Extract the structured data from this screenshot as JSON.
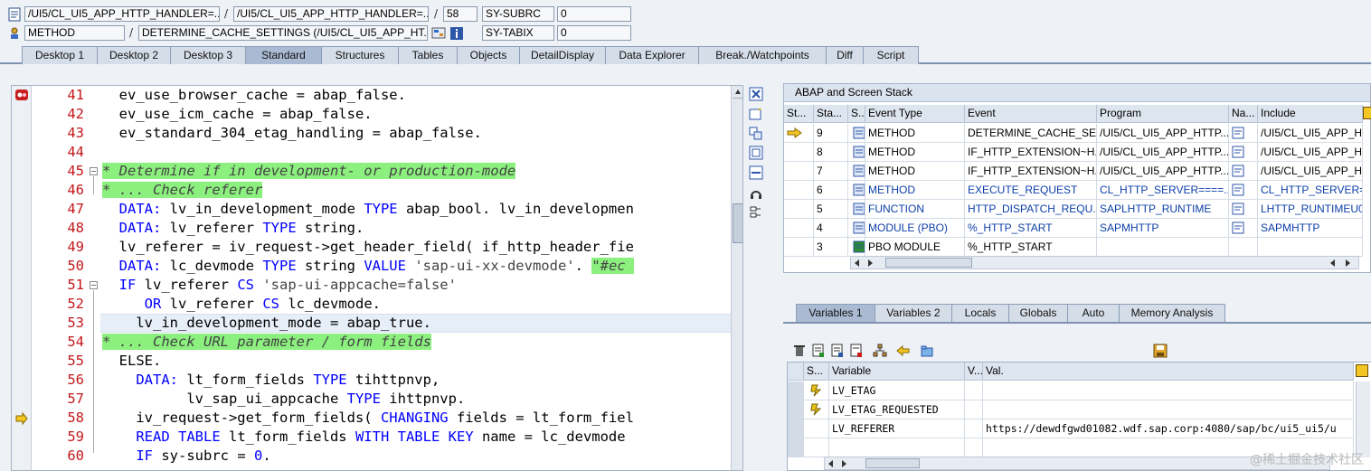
{
  "header": {
    "row1": {
      "prog1": "/UI5/CL_UI5_APP_HTTP_HANDLER=...",
      "prog2": "/UI5/CL_UI5_APP_HTTP_HANDLER=...",
      "line": "58",
      "var_name": "SY-SUBRC",
      "var_value": "0"
    },
    "row2": {
      "type": "METHOD",
      "name": "DETERMINE_CACHE_SETTINGS (/UI5/CL_UI5_APP_HT...",
      "var_name": "SY-TABIX",
      "var_value": "0"
    }
  },
  "tabs": [
    "Desktop 1",
    "Desktop 2",
    "Desktop 3",
    "Standard",
    "Structures",
    "Tables",
    "Objects",
    "DetailDisplay",
    "Data Explorer",
    "Break./Watchpoints",
    "Diff",
    "Script"
  ],
  "active_tab": "Standard",
  "editor": {
    "lines": [
      {
        "num": "41",
        "parts": [
          [
            "ev",
            "  ev_use_browser_cache = abap_false."
          ]
        ]
      },
      {
        "num": "42",
        "parts": [
          [
            "ev",
            "  ev_use_icm_cache = abap_false."
          ]
        ]
      },
      {
        "num": "43",
        "parts": [
          [
            "ev",
            "  ev_standard_304_etag_handling = abap_false."
          ]
        ]
      },
      {
        "num": "44",
        "parts": [
          [
            "ev",
            ""
          ]
        ]
      },
      {
        "num": "45",
        "parts": [
          [
            "cm",
            "* Determine if in development- or production-mode"
          ]
        ]
      },
      {
        "num": "46",
        "parts": [
          [
            "cm",
            "* ... Check referer"
          ]
        ]
      },
      {
        "num": "47",
        "parts": [
          [
            "ev",
            "  "
          ],
          [
            "kw",
            "DATA:"
          ],
          [
            "ev",
            " lv_in_development_mode "
          ],
          [
            "kw",
            "TYPE"
          ],
          [
            "ev",
            " abap_bool. lv_in_developmen"
          ]
        ]
      },
      {
        "num": "48",
        "parts": [
          [
            "ev",
            "  "
          ],
          [
            "kw",
            "DATA:"
          ],
          [
            "ev",
            " lv_referer "
          ],
          [
            "kw",
            "TYPE"
          ],
          [
            "ev",
            " string."
          ]
        ]
      },
      {
        "num": "49",
        "parts": [
          [
            "ev",
            "  lv_referer = iv_request->get_header_field( if_http_header_fie"
          ]
        ]
      },
      {
        "num": "50",
        "parts": [
          [
            "ev",
            "  "
          ],
          [
            "kw",
            "DATA:"
          ],
          [
            "ev",
            " lc_devmode "
          ],
          [
            "kw",
            "TYPE"
          ],
          [
            "ev",
            " string "
          ],
          [
            "kw",
            "VALUE"
          ],
          [
            "ev",
            " "
          ],
          [
            "str",
            "'sap-ui-xx-devmode'"
          ],
          [
            "ev",
            ". "
          ],
          [
            "cm",
            "\"#ec "
          ]
        ]
      },
      {
        "num": "51",
        "parts": [
          [
            "ev",
            "  "
          ],
          [
            "kw",
            "IF"
          ],
          [
            "ev",
            " lv_referer "
          ],
          [
            "kw",
            "CS"
          ],
          [
            "ev",
            " "
          ],
          [
            "str",
            "'sap-ui-appcache=false'"
          ]
        ]
      },
      {
        "num": "52",
        "parts": [
          [
            "ev",
            "     "
          ],
          [
            "kw",
            "OR"
          ],
          [
            "ev",
            " lv_referer "
          ],
          [
            "kw",
            "CS"
          ],
          [
            "ev",
            " lc_devmode."
          ]
        ]
      },
      {
        "num": "53",
        "parts": [
          [
            "ev",
            "    lv_in_development_mode = abap_true."
          ]
        ]
      },
      {
        "num": "54",
        "parts": [
          [
            "cm",
            "* ... Check URL parameter / form fields"
          ]
        ]
      },
      {
        "num": "55",
        "parts": [
          [
            "ev",
            "  ELSE."
          ]
        ]
      },
      {
        "num": "56",
        "parts": [
          [
            "ev",
            "    "
          ],
          [
            "kw",
            "DATA:"
          ],
          [
            "ev",
            " lt_form_fields "
          ],
          [
            "kw",
            "TYPE"
          ],
          [
            "ev",
            " tihttpnvp,"
          ]
        ]
      },
      {
        "num": "57",
        "parts": [
          [
            "ev",
            "          lv_sap_ui_appcache "
          ],
          [
            "kw",
            "TYPE"
          ],
          [
            "ev",
            " ihttpnvp."
          ]
        ]
      },
      {
        "num": "58",
        "parts": [
          [
            "ev",
            "    iv_request->get_form_fields( "
          ],
          [
            "kw",
            "CHANGING"
          ],
          [
            "ev",
            " fields = lt_form_fiel"
          ]
        ]
      },
      {
        "num": "59",
        "parts": [
          [
            "ev",
            "    "
          ],
          [
            "kw",
            "READ TABLE"
          ],
          [
            "ev",
            " lt_form_fields "
          ],
          [
            "kw",
            "WITH TABLE KEY"
          ],
          [
            "ev",
            " name = lc_devmode "
          ]
        ]
      },
      {
        "num": "60",
        "parts": [
          [
            "ev",
            "    "
          ],
          [
            "kw",
            "IF"
          ],
          [
            "ev",
            " sy-subrc = "
          ],
          [
            "lit",
            "0"
          ],
          [
            "ev",
            "."
          ]
        ]
      }
    ]
  },
  "stack": {
    "title": "ABAP and Screen Stack",
    "columns": [
      "St...",
      "Sta...",
      "S...",
      "Event Type",
      "Event",
      "Program",
      "Na...",
      "Include"
    ],
    "rows": [
      {
        "level": "9",
        "type": "METHOD",
        "event": "DETERMINE_CACHE_SET...",
        "program": "/UI5/CL_UI5_APP_HTTP...",
        "include": "/UI5/CL_UI5_APP_H",
        "current": true,
        "link": false
      },
      {
        "level": "8",
        "type": "METHOD",
        "event": "IF_HTTP_EXTENSION~H...",
        "program": "/UI5/CL_UI5_APP_HTTP...",
        "include": "/UI5/CL_UI5_APP_H",
        "current": false,
        "link": false
      },
      {
        "level": "7",
        "type": "METHOD",
        "event": "IF_HTTP_EXTENSION~H...",
        "program": "/UI5/CL_UI5_APP_HTTP...",
        "include": "/UI5/CL_UI5_APP_H",
        "current": false,
        "link": false
      },
      {
        "level": "6",
        "type": "METHOD",
        "event": "EXECUTE_REQUEST",
        "program": "CL_HTTP_SERVER====...",
        "include": "CL_HTTP_SERVER=",
        "current": false,
        "link": true
      },
      {
        "level": "5",
        "type": "FUNCTION",
        "event": "HTTP_DISPATCH_REQU...",
        "program": "SAPLHTTP_RUNTIME",
        "include": "LHTTP_RUNTIMEU0",
        "current": false,
        "link": true
      },
      {
        "level": "4",
        "type": "MODULE (PBO)",
        "event": "%_HTTP_START",
        "program": "SAPMHTTP",
        "include": "SAPMHTTP",
        "current": false,
        "link": true
      },
      {
        "level": "3",
        "type": "PBO MODULE",
        "event": "%_HTTP_START",
        "program": "",
        "include": "",
        "current": false,
        "link": false
      }
    ]
  },
  "var_tabs": [
    "Variables 1",
    "Variables 2",
    "Locals",
    "Globals",
    "Auto",
    "Memory Analysis"
  ],
  "vars": {
    "columns": [
      "S...",
      "Variable",
      "V...",
      "Val."
    ],
    "rows": [
      {
        "name": "LV_ETAG",
        "value": ""
      },
      {
        "name": "LV_ETAG_REQUESTED",
        "value": ""
      },
      {
        "name": "LV_REFERER",
        "value": "https://dewdfgwd01082.wdf.sap.corp:4080/sap/bc/ui5_ui5/u"
      }
    ]
  },
  "watermark": "@稀土掘金技术社区"
}
